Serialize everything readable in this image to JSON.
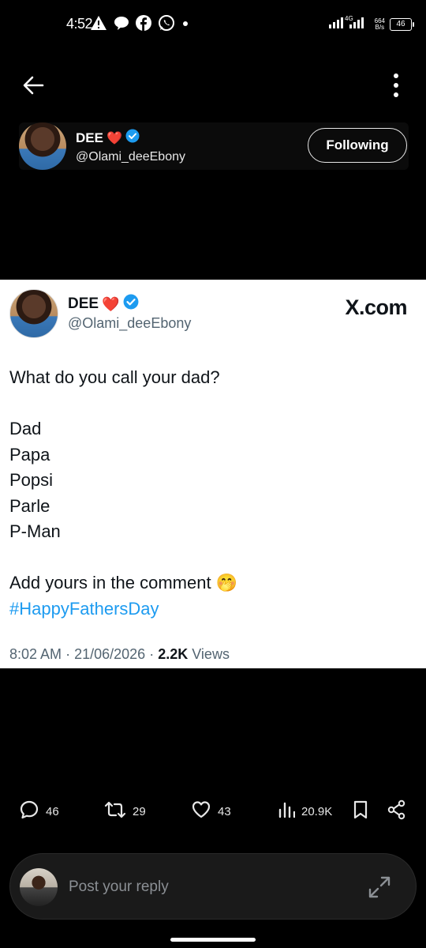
{
  "status_bar": {
    "time": "4:52",
    "network_type": "4G",
    "net_speed_value": "664",
    "net_speed_unit": "B/s",
    "battery": "46",
    "icons": [
      "warning-icon",
      "chat-bubble-icon",
      "facebook-icon",
      "whatsapp-icon",
      "notification-dot-icon",
      "signal-icon",
      "battery-icon"
    ]
  },
  "nav": {
    "icons": [
      "back-arrow-icon",
      "more-vertical-icon"
    ]
  },
  "author": {
    "name": "DEE",
    "emoji": "❤️",
    "handle": "@Olami_deeEbony",
    "follow_label": "Following",
    "verified_color": "#1d9bf0"
  },
  "tweet": {
    "name": "DEE",
    "emoji": "❤️",
    "handle": "@Olami_deeEbony",
    "brand": "X.com",
    "question": "What do you call your dad?",
    "names": [
      "Dad",
      "Papa",
      "Popsi",
      "Parle",
      "P-Man"
    ],
    "closing": "Add yours in the comment 🤭",
    "hashtag": "#HappyFathersDay",
    "time": "8:02 AM",
    "date": "21/06/2026",
    "views_count": "2.2K",
    "views_label": "Views",
    "hashtag_color": "#1d9bf0"
  },
  "actions": {
    "replies": "46",
    "reposts": "29",
    "likes": "43",
    "views": "20.9K",
    "icons": [
      "reply-icon",
      "repost-icon",
      "like-icon",
      "views-icon",
      "bookmark-icon",
      "share-icon"
    ]
  },
  "reply_bar": {
    "placeholder": "Post your reply",
    "icons": [
      "expand-icon"
    ]
  }
}
